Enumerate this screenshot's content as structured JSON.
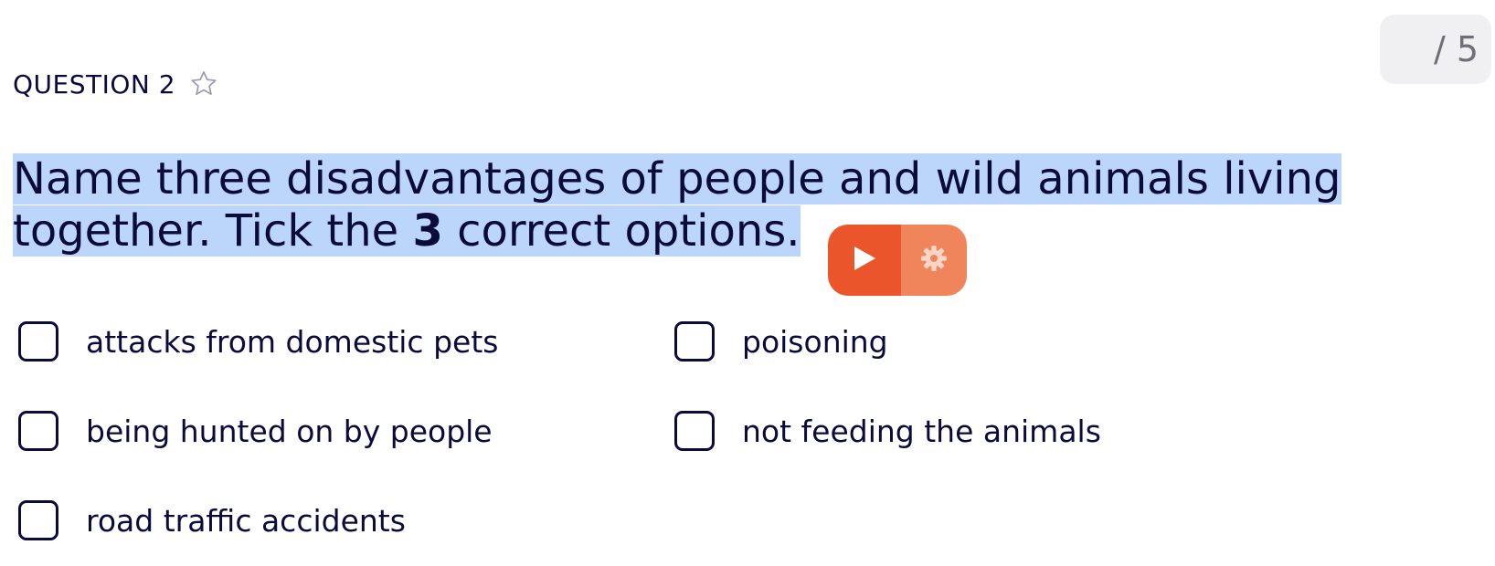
{
  "score": {
    "text": "/ 5"
  },
  "question": {
    "label": "QUESTION 2",
    "prompt_part1": "Name three disadvantages of people and wild animals living together. Tick the ",
    "prompt_bold": "3",
    "prompt_part2": " correct options."
  },
  "tts": {
    "play_icon": "play-icon",
    "settings_icon": "gear-icon",
    "play_color": "#ea552b",
    "settings_color": "#f0855c"
  },
  "options": [
    {
      "label": "attacks from domestic pets",
      "checked": false
    },
    {
      "label": "poisoning",
      "checked": false
    },
    {
      "label": "being hunted on by people",
      "checked": false
    },
    {
      "label": "not feeding the animals",
      "checked": false
    },
    {
      "label": "road traffic accidents",
      "checked": false
    }
  ],
  "colors": {
    "text": "#0b0b3b",
    "highlight": "#bcd6fb",
    "badge_bg": "#f0f0f2"
  }
}
